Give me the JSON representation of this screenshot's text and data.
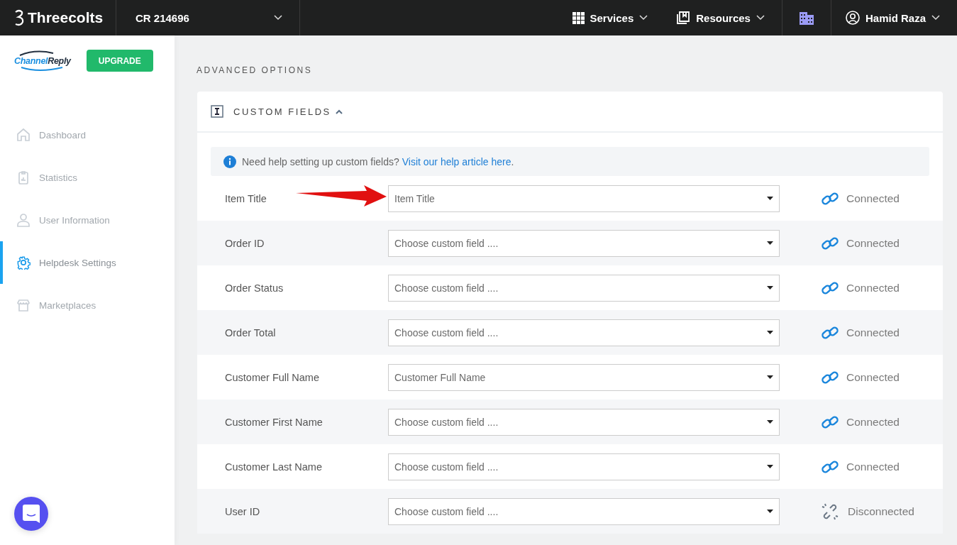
{
  "topbar": {
    "brand": "Threecolts",
    "account": "CR 214696",
    "menus": [
      {
        "label": "Services",
        "kind": "grid"
      },
      {
        "label": "Resources",
        "kind": "book"
      }
    ],
    "user": "Hamid Raza"
  },
  "sidebar": {
    "logo": {
      "word_1": "Channel",
      "word_2": "Reply"
    },
    "upgrade": "UPGRADE",
    "items": [
      {
        "label": "Dashboard",
        "kind": "home",
        "selected": false
      },
      {
        "label": "Statistics",
        "kind": "clipboard",
        "selected": false
      },
      {
        "label": "User Information",
        "kind": "user",
        "selected": false
      },
      {
        "label": "Helpdesk Settings",
        "kind": "gear",
        "selected": true
      },
      {
        "label": "Marketplaces",
        "kind": "store",
        "selected": false
      }
    ]
  },
  "section_title": "ADVANCED OPTIONS",
  "panel": {
    "title": "CUSTOM FIELDS",
    "expanded": true,
    "help": {
      "text": "Need help setting up custom fields?",
      "link": "Visit our help article here",
      "end": "."
    },
    "rows": [
      {
        "label": "Item Title",
        "value": "Item Title",
        "status": "Connected",
        "kind": "connected",
        "pointed": true
      },
      {
        "label": "Order ID",
        "placeholder": "Choose custom field ....",
        "status": "Connected",
        "kind": "connected",
        "pointed": false
      },
      {
        "label": "Order Status",
        "placeholder": "Choose custom field ....",
        "status": "Connected",
        "kind": "connected",
        "pointed": false
      },
      {
        "label": "Order Total",
        "placeholder": "Choose custom field ....",
        "status": "Connected",
        "kind": "connected",
        "pointed": false
      },
      {
        "label": "Customer Full Name",
        "value": "Customer Full Name",
        "status": "Connected",
        "kind": "connected",
        "pointed": false
      },
      {
        "label": "Customer First Name",
        "placeholder": "Choose custom field ....",
        "status": "Connected",
        "kind": "connected",
        "pointed": false
      },
      {
        "label": "Customer Last Name",
        "placeholder": "Choose custom field ....",
        "status": "Connected",
        "kind": "connected",
        "pointed": false
      },
      {
        "label": "User ID",
        "placeholder": "Choose custom field ....",
        "status": "Disconnected",
        "kind": "disconnected",
        "pointed": false
      }
    ]
  }
}
